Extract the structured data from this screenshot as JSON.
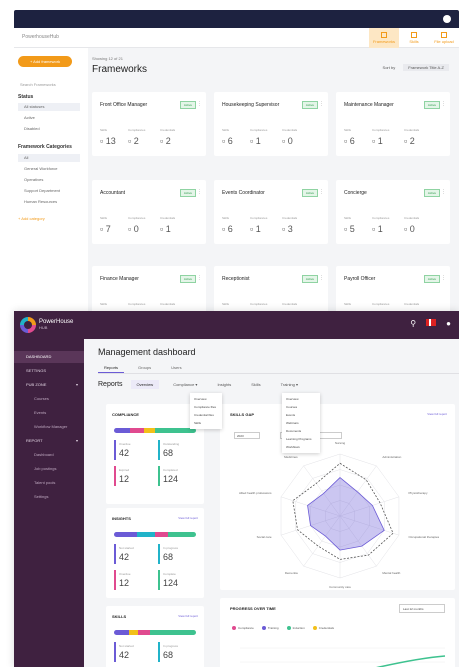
{
  "top": {
    "org_label": "PowerhouseHub",
    "actions": [
      {
        "label": "Frameworks",
        "active": true
      },
      {
        "label": "Skills",
        "active": false
      },
      {
        "label": "File upload",
        "active": false
      }
    ],
    "add_button": "+ Add framework",
    "search_placeholder": "Search Frameworks",
    "status_heading": "Status",
    "status_items": [
      "All statuses",
      "Active",
      "Disabled"
    ],
    "categories_heading": "Framework Categories",
    "category_items": [
      "All",
      "General Workforce",
      "Operatives",
      "Support Department",
      "Human Resources"
    ],
    "add_category": "+ Add category",
    "showing": "Showing 12 of 21",
    "title": "Frameworks",
    "sort_label": "Sort by",
    "sort_value": "Framework Title A-Z",
    "stat_labels": [
      "Skills",
      "Compliances",
      "Credentials"
    ],
    "cards": [
      {
        "name": "Front Office Manager",
        "badge": "Active",
        "skills": "13",
        "compliances": "2",
        "credentials": "2"
      },
      {
        "name": "Housekeeping Supervisor",
        "badge": "Active",
        "skills": "6",
        "compliances": "1",
        "credentials": "0"
      },
      {
        "name": "Maintenance Manager",
        "badge": "Active",
        "skills": "6",
        "compliances": "1",
        "credentials": "2"
      },
      {
        "name": "Accountant",
        "badge": "Active",
        "skills": "7",
        "compliances": "0",
        "credentials": "1"
      },
      {
        "name": "Events Coordinator",
        "badge": "Active",
        "skills": "6",
        "compliances": "1",
        "credentials": "3"
      },
      {
        "name": "Concierge",
        "badge": "Active",
        "skills": "5",
        "compliances": "1",
        "credentials": "0"
      },
      {
        "name": "Finance Manager",
        "badge": "Active",
        "skills": "12",
        "compliances": "1",
        "credentials": "1"
      },
      {
        "name": "Receptionist",
        "badge": "Active",
        "skills": "8",
        "compliances": "1",
        "credentials": "0"
      },
      {
        "name": "Payroll Officer",
        "badge": "Active",
        "skills": "7",
        "compliances": "1",
        "credentials": "0"
      }
    ]
  },
  "bottom": {
    "logo_name": "PowerHouse",
    "logo_sub": "HUB",
    "sidebar": [
      {
        "label": "DASHBOARD",
        "active": true,
        "sub": false,
        "caret": false
      },
      {
        "label": "SETTINGS",
        "active": false,
        "sub": false,
        "caret": false
      },
      {
        "label": "PUB ZONE",
        "active": false,
        "sub": false,
        "caret": true
      },
      {
        "label": "Courses",
        "active": false,
        "sub": true,
        "caret": false
      },
      {
        "label": "Events",
        "active": false,
        "sub": true,
        "caret": false
      },
      {
        "label": "Workflow Manager",
        "active": false,
        "sub": true,
        "caret": false
      },
      {
        "label": "REPORT",
        "active": false,
        "sub": false,
        "caret": true
      },
      {
        "label": "Dashboard",
        "active": false,
        "sub": true,
        "caret": false
      },
      {
        "label": "Job postings",
        "active": false,
        "sub": true,
        "caret": false
      },
      {
        "label": "Talent pools",
        "active": false,
        "sub": true,
        "caret": false
      },
      {
        "label": "Settings",
        "active": false,
        "sub": true,
        "caret": false
      }
    ],
    "title": "Management dashboard",
    "tabs": [
      "Reports",
      "Groups",
      "Users"
    ],
    "reports_title": "Reports",
    "report_chips": [
      "Overview",
      "Compliance ▾",
      "Insights",
      "Skills",
      "Training ▾"
    ],
    "compliance_menu": [
      "Overview",
      "Compliance files",
      "Credential files",
      "Skills"
    ],
    "training_menu": [
      "Overview",
      "Courses",
      "Events",
      "Webinars",
      "Documents",
      "Learning Programs",
      "Workflows"
    ],
    "compliance_card": {
      "title": "COMPLIANCE",
      "tiles": [
        {
          "label": "Overdue",
          "value": "42"
        },
        {
          "label": "Outstanding",
          "value": "68"
        },
        {
          "label": "Expired",
          "value": "12"
        },
        {
          "label": "Completed",
          "value": "124"
        }
      ]
    },
    "insights_card": {
      "title": "INSIGHTS",
      "link": "View full report",
      "tiles": [
        {
          "label": "Not started",
          "value": "42"
        },
        {
          "label": "In progress",
          "value": "68"
        },
        {
          "label": "Overdue",
          "value": "12"
        },
        {
          "label": "Complete",
          "value": "124"
        }
      ]
    },
    "skills_mini_card": {
      "title": "SKILLS",
      "link": "View full report",
      "tiles": [
        {
          "label": "Not started",
          "value": "42"
        },
        {
          "label": "In progress",
          "value": "68"
        }
      ]
    },
    "skills_chart": {
      "title": "SKILLS GAP",
      "link": "View full report",
      "select1": "2023",
      "select2": "Select framework",
      "axes": [
        "Nursing",
        "Administration",
        "Physiotherapy",
        "Occupational therapies",
        "Mental health",
        "Community care",
        "Dementia",
        "Social care",
        "Allied health professions",
        "Medicines"
      ]
    },
    "progress_card": {
      "title": "PROGRESS OVER TIME",
      "range": "Last 12 months",
      "legend": [
        {
          "label": "Compliance",
          "color": "#e04a8f"
        },
        {
          "label": "Training",
          "color": "#6b5bd6"
        },
        {
          "label": "Induction",
          "color": "#3ec28f"
        },
        {
          "label": "Credentials",
          "color": "#f2c019"
        }
      ]
    }
  }
}
